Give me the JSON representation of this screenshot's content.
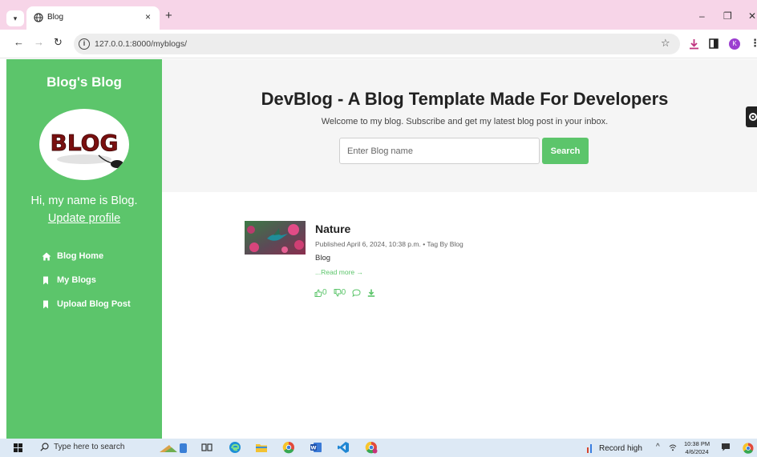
{
  "browser": {
    "tab_title": "Blog",
    "tab_close": "×",
    "new_tab": "+",
    "url": "127.0.0.1:8000/myblogs/",
    "window_controls": {
      "minimize": "–",
      "restore": "❐",
      "close": "✕"
    },
    "profile_initial": "K"
  },
  "sidebar": {
    "title": "Blog's Blog",
    "logo_text": "BLOG",
    "greeting": "Hi, my name is Blog.",
    "update_link": "Update profile",
    "nav": [
      {
        "label": "Blog Home",
        "icon": "home-icon"
      },
      {
        "label": "My Blogs",
        "icon": "bookmark-icon"
      },
      {
        "label": "Upload Blog Post",
        "icon": "bookmark-icon"
      }
    ]
  },
  "header": {
    "title": "DevBlog - A Blog Template Made For Developers",
    "subtitle": "Welcome to my blog. Subscribe and get my latest blog post in your inbox.",
    "search_placeholder": "Enter Blog name",
    "search_button": "Search"
  },
  "post": {
    "title": "Nature",
    "meta": "Published April 6, 2024, 10:38 p.m.  •  Tag By Blog",
    "excerpt": "Blog",
    "read_more": "...Read more →",
    "likes": "0",
    "dislikes": "0"
  },
  "taskbar": {
    "search_text": "Type here to search",
    "record_text": "Record high",
    "time": "10:38 PM",
    "date": "4/6/2024"
  },
  "colors": {
    "accent_green": "#5cc56b",
    "tab_strip_pink": "#f7d5e8",
    "taskbar_blue": "#dde9f5"
  }
}
